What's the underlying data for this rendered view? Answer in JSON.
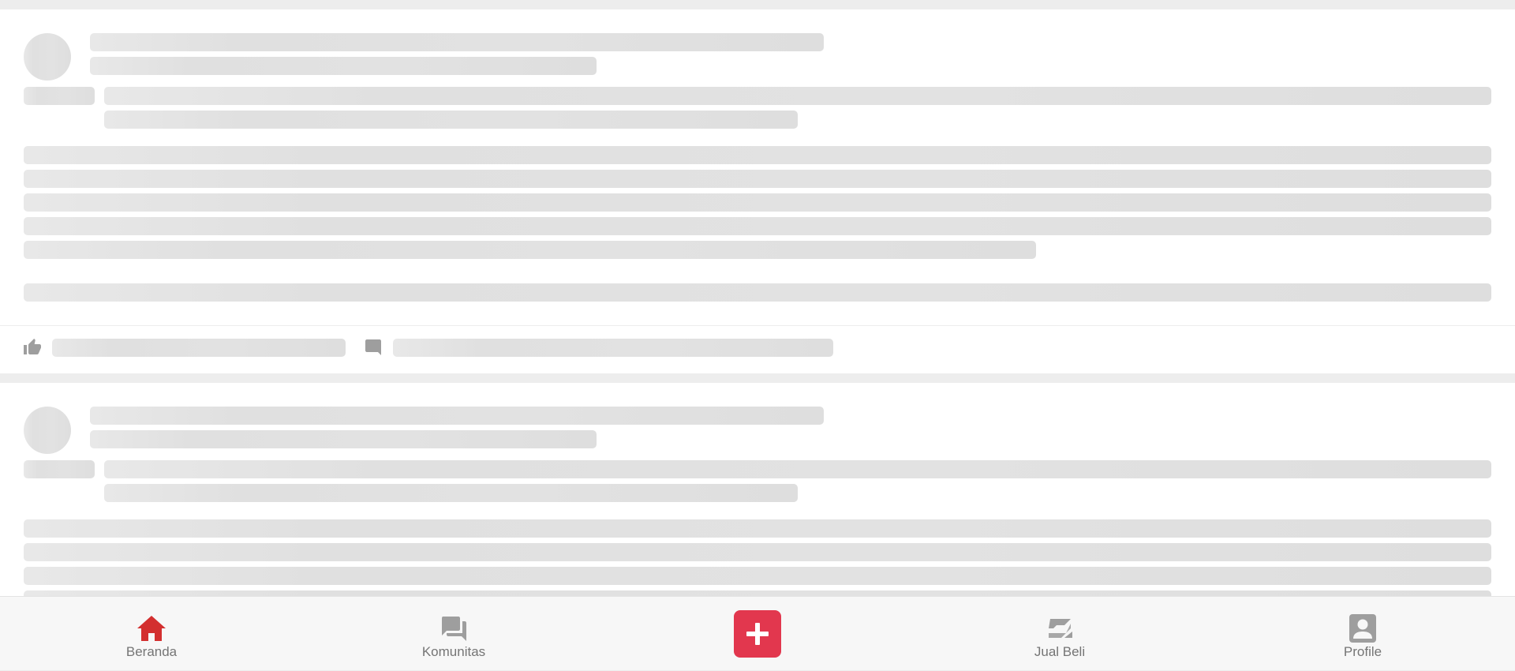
{
  "colors": {
    "accent": "#e2374e",
    "home_active": "#d32f2f",
    "icon_inactive": "#9e9e9e",
    "skeleton": "#e0e0e0",
    "background": "#ededed"
  },
  "bottom_nav": {
    "items": [
      {
        "label": "Beranda",
        "icon": "home-icon",
        "active": true
      },
      {
        "label": "Komunitas",
        "icon": "forum-icon",
        "active": false
      },
      {
        "label": "Jual Beli",
        "icon": "marketplace-icon",
        "active": false
      },
      {
        "label": "Profile",
        "icon": "account-box-icon",
        "active": false
      }
    ],
    "add_button": {
      "icon": "plus-icon"
    }
  },
  "feed": {
    "state": "loading",
    "post_actions": [
      "thumb-up-icon",
      "comment-icon"
    ]
  }
}
